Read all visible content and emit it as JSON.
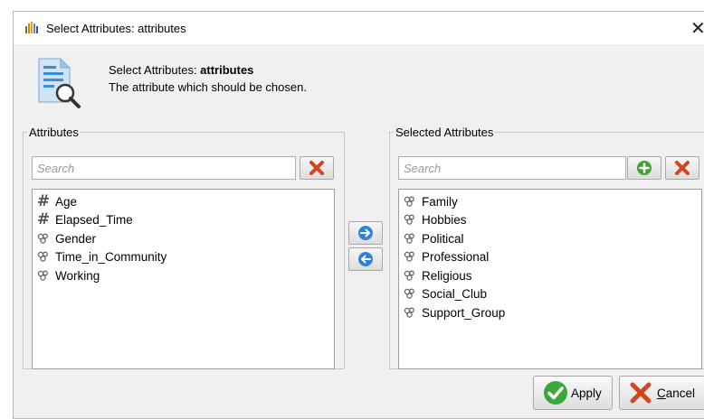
{
  "window": {
    "title": "Select Attributes: attributes",
    "close_glyph": "✕"
  },
  "header": {
    "prefix": "Select Attributes: ",
    "name": "attributes",
    "description": "The attribute which should be chosen."
  },
  "left_panel": {
    "legend": "Attributes",
    "search_placeholder": "Search",
    "items": [
      {
        "label": "Age",
        "icon": "numeric-icon"
      },
      {
        "label": "Elapsed_Time",
        "icon": "numeric-icon"
      },
      {
        "label": "Gender",
        "icon": "nominal-icon"
      },
      {
        "label": "Time_in_Community",
        "icon": "nominal-icon"
      },
      {
        "label": "Working",
        "icon": "nominal-icon"
      }
    ]
  },
  "right_panel": {
    "legend": "Selected Attributes",
    "search_placeholder": "Search",
    "items": [
      {
        "label": "Family",
        "icon": "nominal-icon"
      },
      {
        "label": "Hobbies",
        "icon": "nominal-icon"
      },
      {
        "label": "Political",
        "icon": "nominal-icon"
      },
      {
        "label": "Professional",
        "icon": "nominal-icon"
      },
      {
        "label": "Religious",
        "icon": "nominal-icon"
      },
      {
        "label": "Social_Club",
        "icon": "nominal-icon"
      },
      {
        "label": "Support_Group",
        "icon": "nominal-icon"
      }
    ]
  },
  "buttons": {
    "apply": "Apply",
    "cancel_mnemonic": "C",
    "cancel_rest": "ancel"
  },
  "colors": {
    "remove_red": "#d2451e",
    "add_green": "#3ba22e",
    "arrow_blue": "#2f83d6",
    "check_green": "#3aa83a"
  }
}
